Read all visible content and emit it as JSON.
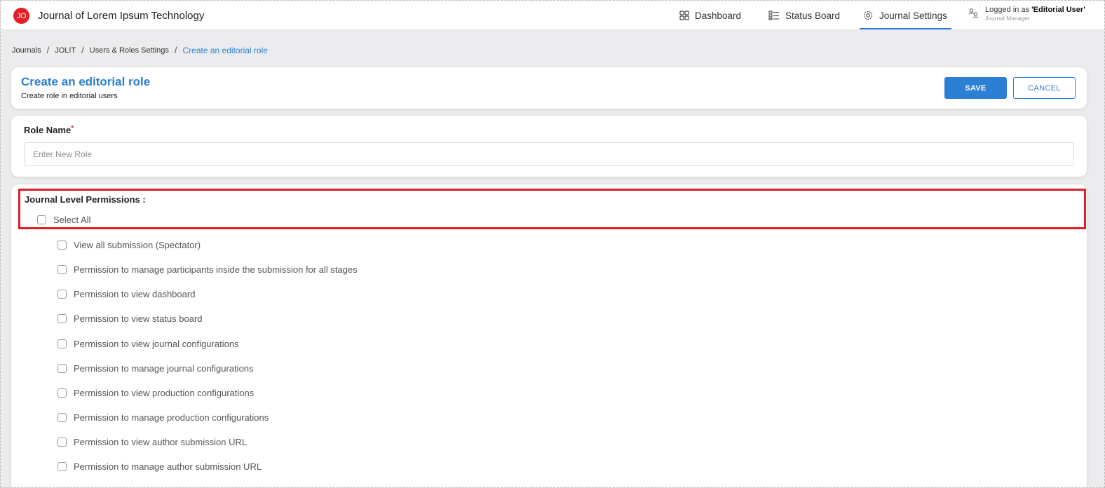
{
  "app": {
    "logo_initials": "JO",
    "title": "Journal of Lorem Ipsum Technology",
    "brand_color": "#e31e24",
    "accent_color": "#2d7fd3"
  },
  "nav": {
    "items": [
      {
        "label": "Dashboard",
        "icon": "grid-icon"
      },
      {
        "label": "Status Board",
        "icon": "board-icon"
      },
      {
        "label": "Journal Settings",
        "icon": "gear-icon",
        "active": true
      }
    ]
  },
  "user": {
    "prefix": "Logged in as ",
    "name": "'Editorial User'",
    "role": "Journal Manager"
  },
  "breadcrumb": {
    "items": [
      "Journals",
      "JOLIT",
      "Users & Roles Settings"
    ],
    "current": "Create an editorial role"
  },
  "header": {
    "title": "Create an editorial role",
    "subtitle": "Create role in editorial users",
    "save_label": "SAVE",
    "cancel_label": "CANCEL"
  },
  "role_form": {
    "label": "Role Name",
    "required_mark": "*",
    "placeholder": "Enter New Role",
    "value": ""
  },
  "permissions": {
    "title": "Journal Level Permissions :",
    "select_all_label": "Select All",
    "items": [
      "View all submission (Spectator)",
      "Permission to manage participants inside the submission for all stages",
      "Permission to view dashboard",
      "Permission to view status board",
      "Permission to view journal configurations",
      "Permission to manage journal configurations",
      "Permission to view production configurations",
      "Permission to manage production configurations",
      "Permission to view author submission URL",
      "Permission to manage author submission URL"
    ]
  }
}
